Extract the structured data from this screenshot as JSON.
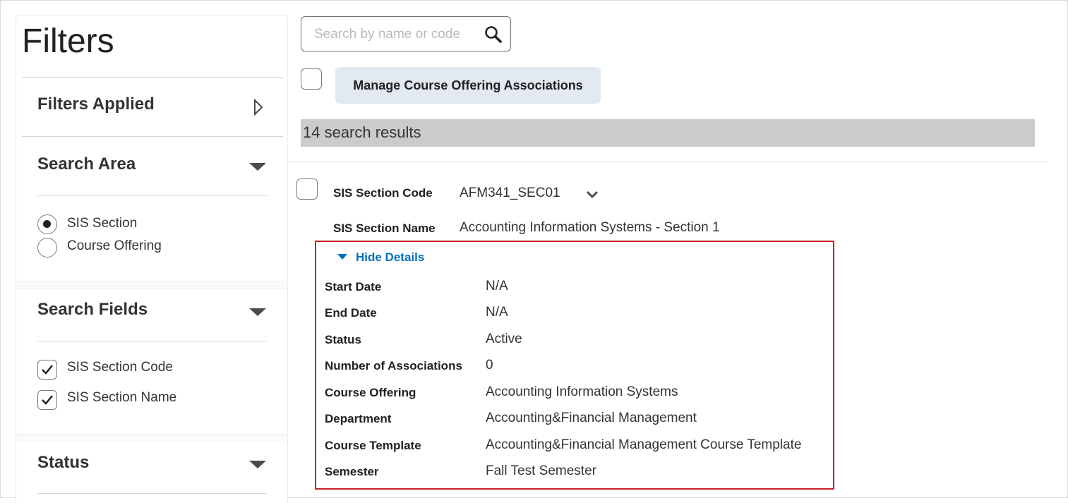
{
  "sidebar": {
    "title": "Filters",
    "filters_applied": {
      "label": "Filters Applied"
    },
    "search_area": {
      "label": "Search Area",
      "options": [
        {
          "label": "SIS Section",
          "selected": true
        },
        {
          "label": "Course Offering",
          "selected": false
        }
      ]
    },
    "search_fields": {
      "label": "Search Fields",
      "options": [
        {
          "label": "SIS Section Code",
          "checked": true
        },
        {
          "label": "SIS Section Name",
          "checked": true
        }
      ]
    },
    "status": {
      "label": "Status"
    }
  },
  "search": {
    "placeholder": "Search by name or code"
  },
  "toolbar": {
    "manage_label": "Manage Course Offering Associations"
  },
  "results": {
    "summary": "14 search results"
  },
  "record": {
    "code_label": "SIS Section Code",
    "code_value": "AFM341_SEC01",
    "name_label": "SIS Section Name",
    "name_value": "Accounting Information Systems - Section 1",
    "toggle_label": "Hide Details",
    "details": [
      {
        "label": "Start Date",
        "value": "N/A"
      },
      {
        "label": "End Date",
        "value": "N/A"
      },
      {
        "label": "Status",
        "value": "Active"
      },
      {
        "label": "Number of Associations",
        "value": "0"
      },
      {
        "label": "Course Offering",
        "value": "Accounting Information Systems"
      },
      {
        "label": "Department",
        "value": "Accounting&Financial Management"
      },
      {
        "label": "Course Template",
        "value": "Accounting&Financial Management Course Template"
      },
      {
        "label": "Semester",
        "value": "Fall Test Semester"
      }
    ]
  },
  "colors": {
    "link": "#006fbf",
    "highlight_border": "#cd2026",
    "results_bar": "#cbcbcb",
    "button_bg": "#e3e9f1"
  }
}
